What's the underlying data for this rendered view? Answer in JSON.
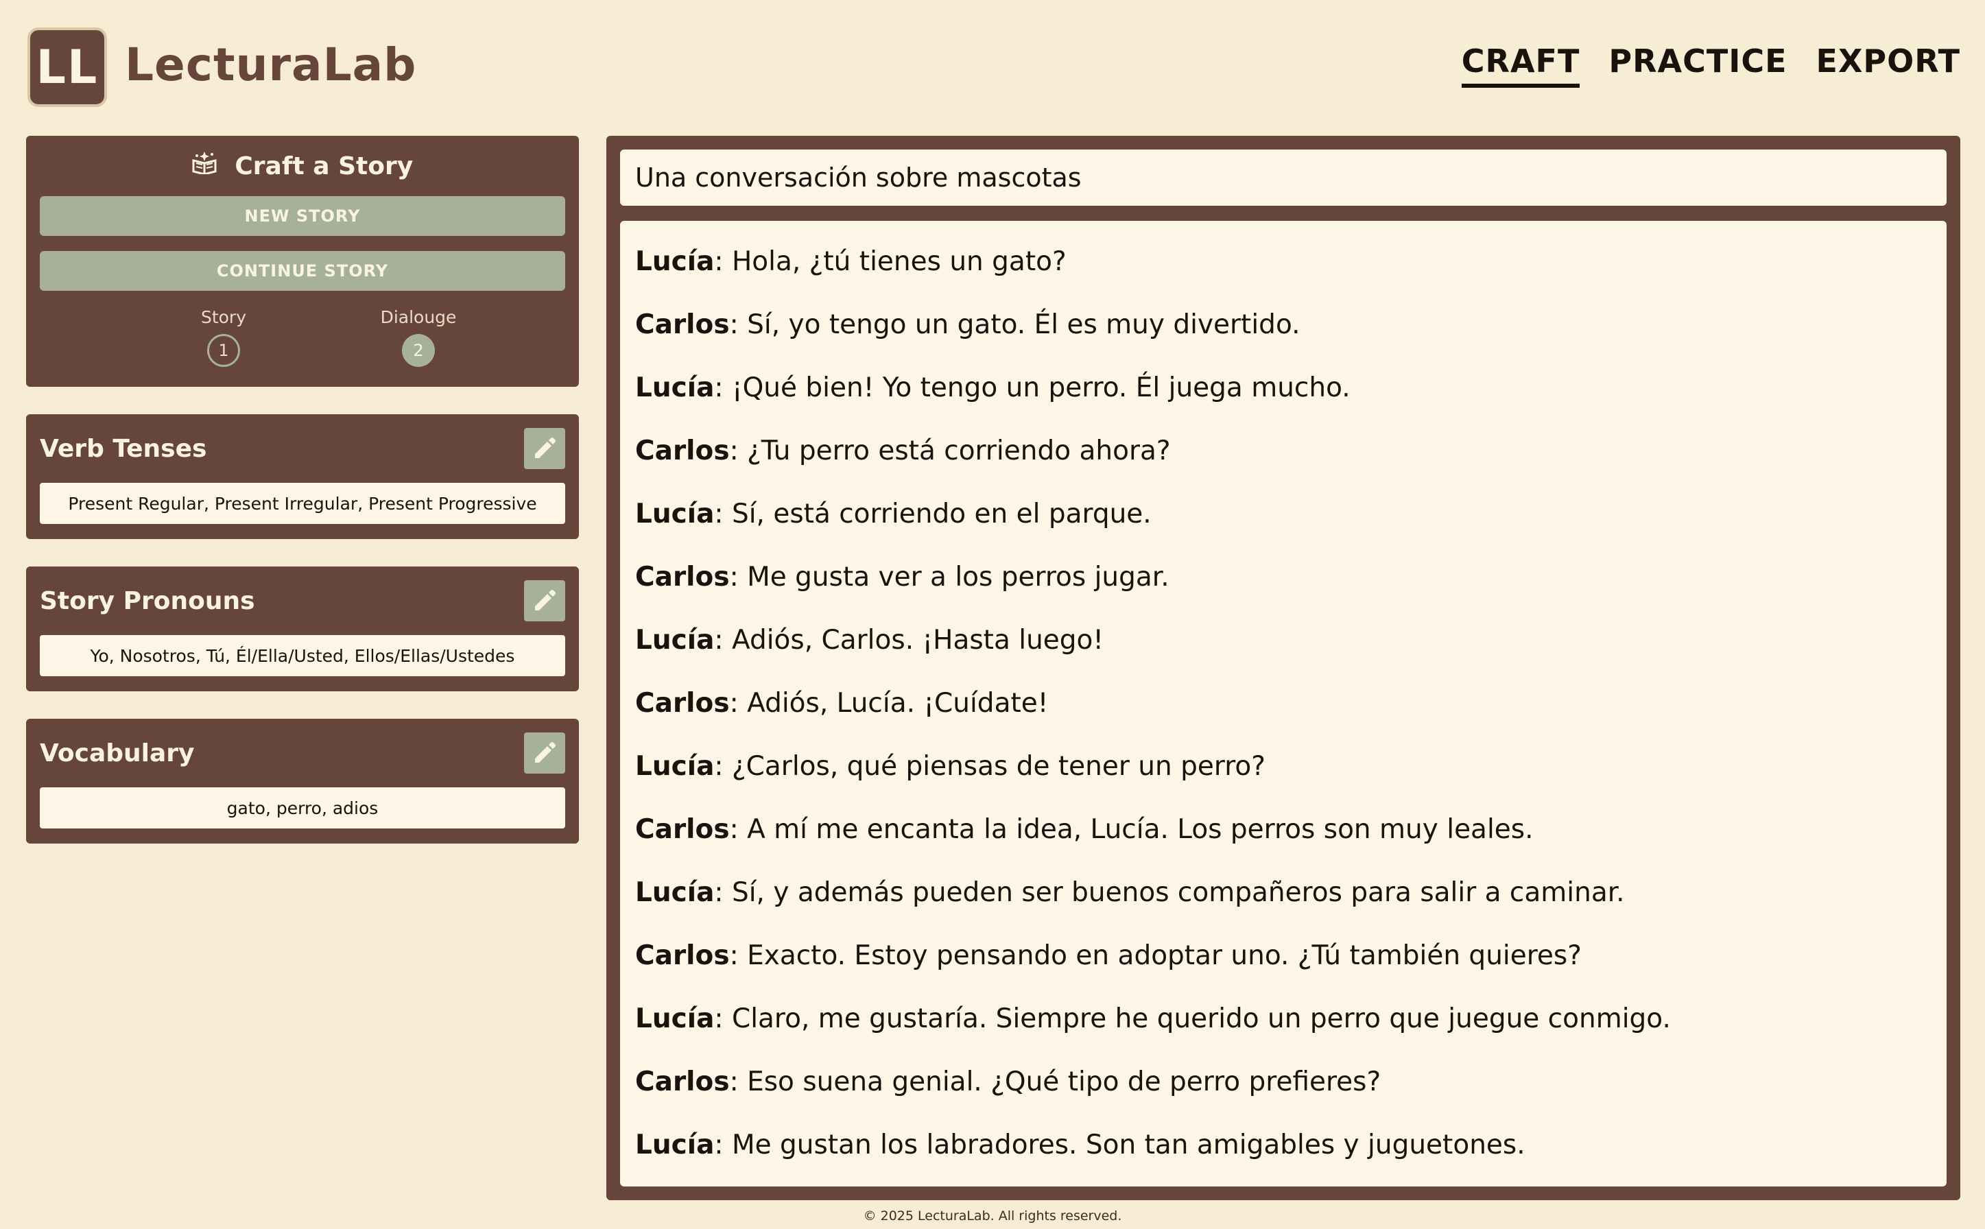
{
  "brand": {
    "logo_text": "LL",
    "name": "LecturaLab"
  },
  "nav": {
    "items": [
      "CRAFT",
      "PRACTICE",
      "EXPORT"
    ],
    "active": "CRAFT"
  },
  "craft": {
    "icon": "book-sparkle-icon",
    "title": "Craft a Story",
    "new_story_label": "NEW STORY",
    "continue_story_label": "CONTINUE STORY",
    "steps": [
      {
        "label": "Story",
        "number": "1",
        "state": "inactive"
      },
      {
        "label": "Dialouge",
        "number": "2",
        "state": "active"
      }
    ]
  },
  "settings": {
    "verb_tenses": {
      "title": "Verb Tenses",
      "value": "Present Regular, Present Irregular, Present Progressive"
    },
    "pronouns": {
      "title": "Story Pronouns",
      "value": "Yo, Nosotros, Tú, Él/Ella/Usted, Ellos/Ellas/Ustedes"
    },
    "vocabulary": {
      "title": "Vocabulary",
      "value": "gato, perro, adios"
    }
  },
  "story": {
    "title": "Una conversación sobre mascotas",
    "lines": [
      {
        "speaker": "Lucía",
        "text": ": Hola, ¿tú tienes un gato?"
      },
      {
        "speaker": "Carlos",
        "text": ": Sí, yo tengo un gato. Él es muy divertido."
      },
      {
        "speaker": "Lucía",
        "text": ": ¡Qué bien! Yo tengo un perro. Él juega mucho."
      },
      {
        "speaker": "Carlos",
        "text": ": ¿Tu perro está corriendo ahora?"
      },
      {
        "speaker": "Lucía",
        "text": ": Sí, está corriendo en el parque."
      },
      {
        "speaker": "Carlos",
        "text": ": Me gusta ver a los perros jugar."
      },
      {
        "speaker": "Lucía",
        "text": ": Adiós, Carlos. ¡Hasta luego!"
      },
      {
        "speaker": "Carlos",
        "text": ": Adiós, Lucía. ¡Cuídate!"
      },
      {
        "speaker": "Lucía",
        "text": ": ¿Carlos, qué piensas de tener un perro?"
      },
      {
        "speaker": "Carlos",
        "text": ": A mí me encanta la idea, Lucía. Los perros son muy leales."
      },
      {
        "speaker": "Lucía",
        "text": ": Sí, y además pueden ser buenos compañeros para salir a caminar."
      },
      {
        "speaker": "Carlos",
        "text": ": Exacto. Estoy pensando en adoptar uno. ¿Tú también quieres?"
      },
      {
        "speaker": "Lucía",
        "text": ": Claro, me gustaría. Siempre he querido un perro que juegue conmigo."
      },
      {
        "speaker": "Carlos",
        "text": ": Eso suena genial. ¿Qué tipo de perro prefieres?"
      },
      {
        "speaker": "Lucía",
        "text": ": Me gustan los labradores. Son tan amigables y juguetones."
      }
    ]
  },
  "footer": {
    "text": "© 2025 LecturaLab. All rights reserved."
  },
  "colors": {
    "panel": "#66463a",
    "accent": "#a6b198",
    "background": "#f7edd4",
    "card": "#fdf6e7"
  }
}
